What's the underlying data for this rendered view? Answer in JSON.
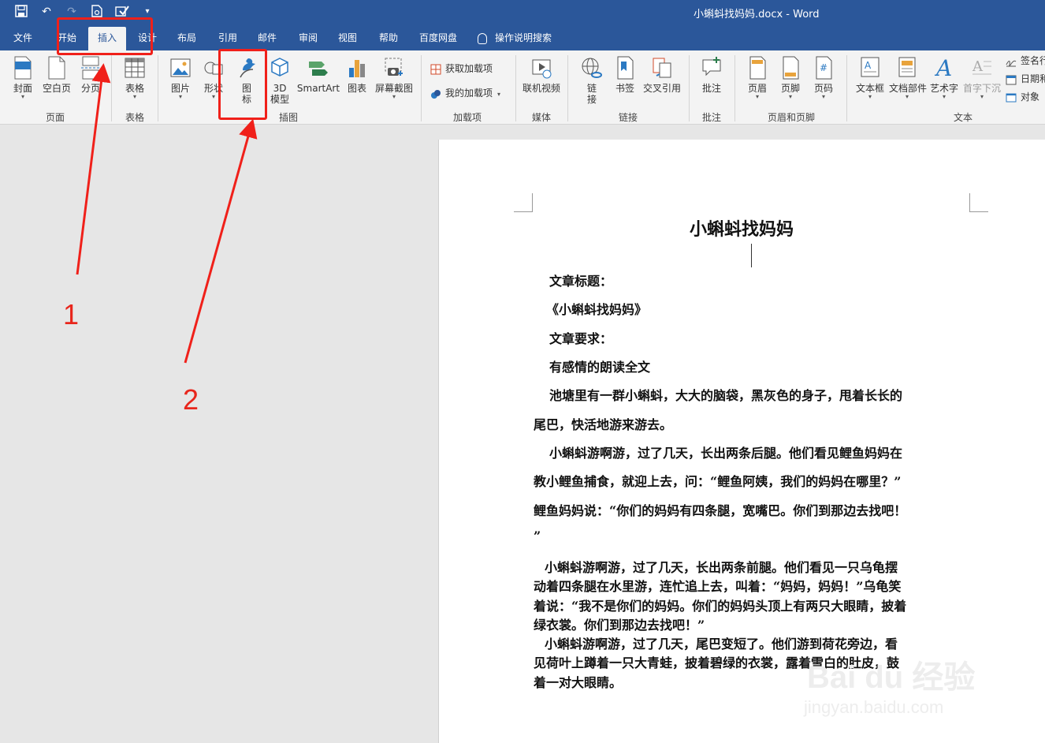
{
  "title_bar": {
    "document_title": "小蝌蚪找妈妈.docx  -  Word",
    "qat_icons": [
      "save-icon",
      "undo-icon",
      "redo-icon",
      "print-preview-icon",
      "check-icon",
      "customize-qat-icon"
    ]
  },
  "tabs": {
    "file": "文件",
    "home": "开始",
    "insert": "插入",
    "design": "设计",
    "layout": "布局",
    "references": "引用",
    "mailings": "邮件",
    "review": "审阅",
    "view": "视图",
    "help": "帮助",
    "baidu": "百度网盘",
    "tell_me": "操作说明搜索",
    "active": "插入"
  },
  "ribbon": {
    "pages": {
      "cover": "封面",
      "blank": "空白页",
      "break": "分页",
      "group": "页面"
    },
    "tables": {
      "table": "表格",
      "group": "表格"
    },
    "illustrations": {
      "pictures": "图片",
      "shapes": "形状",
      "icons_1": "图",
      "icons_2": "标",
      "model_1": "3D",
      "model_2": "模型",
      "smartart": "SmartArt",
      "chart": "图表",
      "screenshot": "屏幕截图",
      "group": "插图"
    },
    "addins": {
      "get": "获取加载项",
      "my": "我的加载项",
      "group": "加载项"
    },
    "media": {
      "online_video": "联机视频",
      "group": "媒体"
    },
    "links": {
      "link_1": "链",
      "link_2": "接",
      "bookmark": "书签",
      "cross_ref": "交叉引用",
      "group": "链接"
    },
    "comments": {
      "comment": "批注",
      "group": "批注"
    },
    "header_footer": {
      "header": "页眉",
      "footer": "页脚",
      "page_number": "页码",
      "group": "页眉和页脚"
    },
    "text": {
      "textbox": "文本框",
      "quick_parts": "文档部件",
      "wordart": "艺术字",
      "dropcap": "首字下沉",
      "signature": "签名行",
      "datetime": "日期和",
      "object": "对象",
      "group": "文本"
    }
  },
  "document": {
    "heading": "小蝌蚪找妈妈",
    "lines": [
      "文章标题：",
      "《小蝌蚪找妈妈》",
      "文章要求：",
      "有感情的朗读全文",
      "池塘里有一群小蝌蚪，大大的脑袋，黑灰色的身子，甩着长长的",
      "尾巴，快活地游来游去。",
      "小蝌蚪游啊游，过了几天，长出两条后腿。他们看见鲤鱼妈妈在",
      "教小鲤鱼捕食，就迎上去，问：“鲤鱼阿姨，我们的妈妈在哪里？”",
      "鲤鱼妈妈说：“你们的妈妈有四条腿，宽嘴巴。你们到那边去找吧！",
      "”",
      "小蝌蚪游啊游，过了几天，长出两条前腿。他们看见一只乌龟摆",
      "动着四条腿在水里游，连忙追上去，叫着：“妈妈，妈妈！”乌龟笑",
      "着说：“我不是你们的妈妈。你们的妈妈头顶上有两只大眼睛，披着",
      "绿衣裳。你们到那边去找吧！”",
      "小蝌蚪游啊游，过了几天，尾巴变短了。他们游到荷花旁边，看",
      "见荷叶上蹲着一只大青蛙，披着碧绿的衣裳，露着雪白的肚皮，鼓",
      "着一对大眼睛。"
    ]
  },
  "annotations": {
    "step1": "1",
    "step2": "2",
    "color": "#f0201a"
  },
  "watermark": {
    "brand": "Bai du 经验",
    "url": "jingyan.baidu.com"
  },
  "colors": {
    "accent": "#2b579a",
    "ribbon_bg": "#f3f3f3",
    "workspace_bg": "#e6e6e6"
  }
}
